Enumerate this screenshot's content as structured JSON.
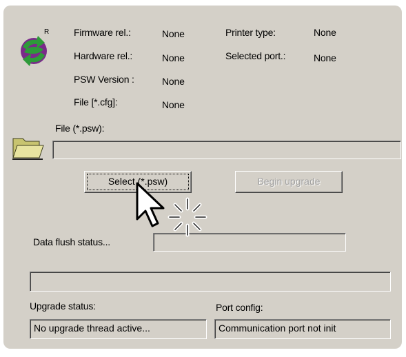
{
  "info": {
    "firmware_label": "Firmware rel.:",
    "firmware_value": "None",
    "hardware_label": "Hardware rel.:",
    "hardware_value": "None",
    "psw_version_label": "PSW Version :",
    "psw_version_value": "None",
    "file_cfg_label": "File [*.cfg]:",
    "file_cfg_value": "None",
    "printer_type_label": "Printer type:",
    "printer_type_value": "None",
    "selected_port_label": "Selected port.:",
    "selected_port_value": "None"
  },
  "file_psw": {
    "label": "File (*.psw):",
    "value": ""
  },
  "buttons": {
    "select_label": "Select (*.psw)",
    "begin_upgrade_label": "Begin upgrade"
  },
  "data_flush": {
    "label": "Data flush status...",
    "value": ""
  },
  "progress": {
    "value": ""
  },
  "upgrade_status": {
    "label": "Upgrade status:",
    "value": "No upgrade thread active..."
  },
  "port_config": {
    "label": "Port config:",
    "value": "Communication port not init"
  },
  "logo_mark": "R",
  "colors": {
    "panel": "#d4d0c8",
    "logo_green": "#2e9a3a",
    "logo_purple": "#7a2a8a",
    "folder": "#e8e4a0"
  },
  "icons": [
    "logo-icon",
    "folder-icon",
    "mouse-cursor-icon",
    "loading-spinner-icon"
  ]
}
